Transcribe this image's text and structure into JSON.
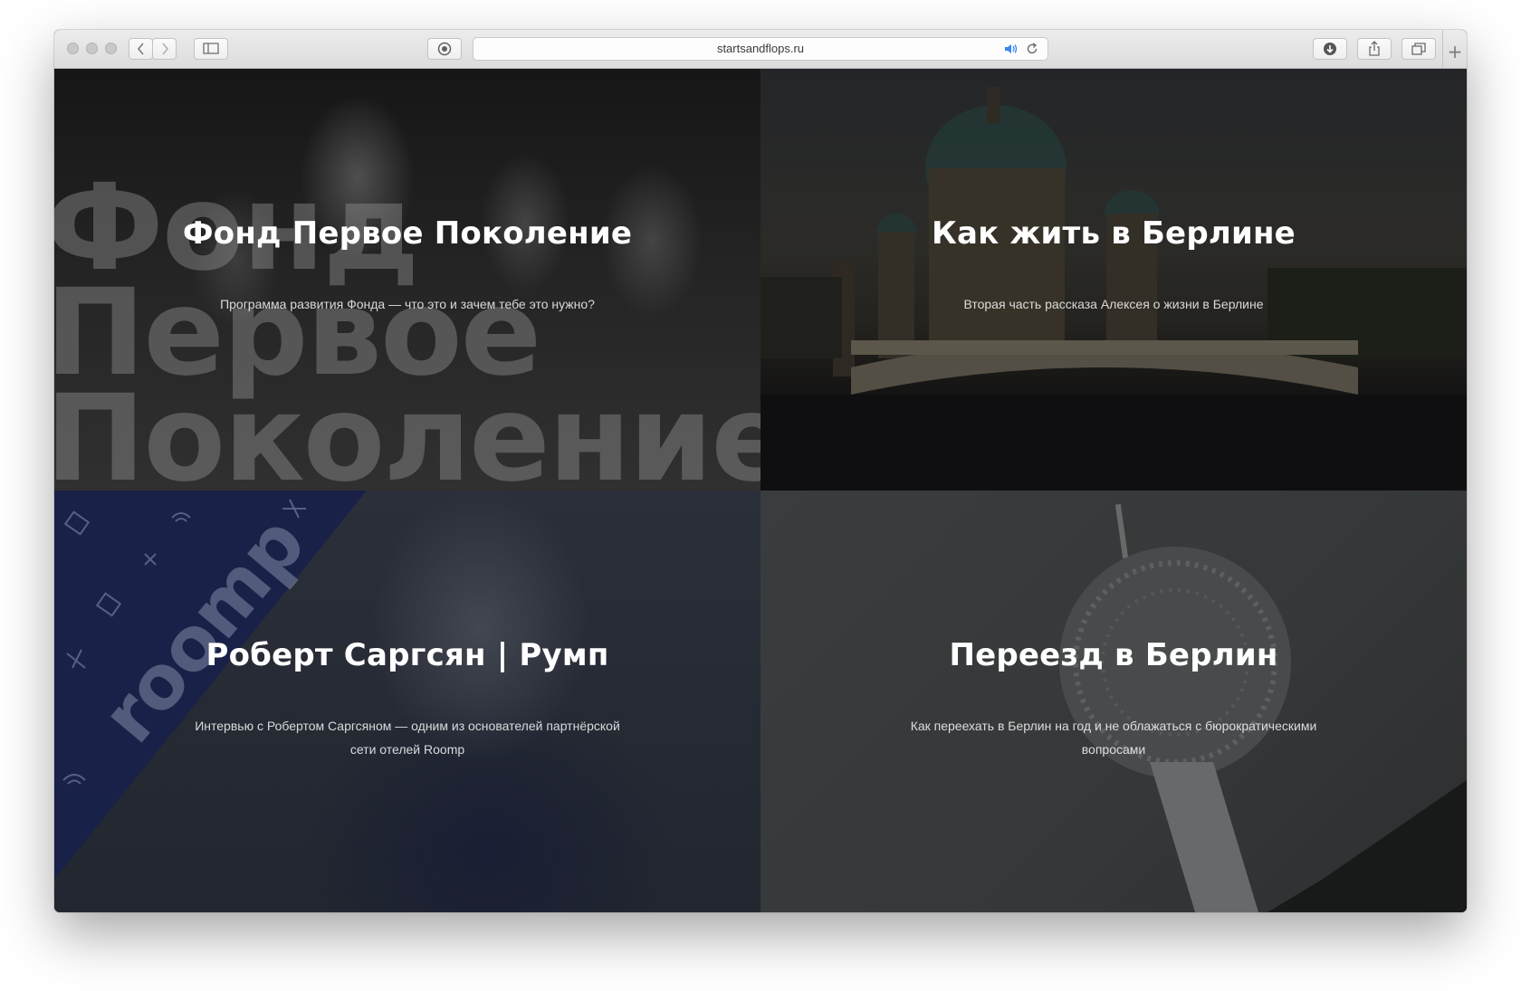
{
  "browser": {
    "url": "startsandflops.ru",
    "icons": {
      "back": "chevron-left-icon",
      "forward": "chevron-right-icon",
      "sidebar": "sidebar-icon",
      "extension": "camera-icon",
      "audio": "speaker-icon",
      "reload": "reload-icon",
      "download": "download-icon",
      "share": "share-icon",
      "tabs": "tabs-icon",
      "new_tab": "plus-icon"
    }
  },
  "cards": [
    {
      "title": "Фонд Первое Поколение",
      "description": "Программа развития Фонда — что это и зачем тебе это нужно?",
      "background_words": [
        "Фонд",
        "Первое",
        "Поколение"
      ]
    },
    {
      "title": "Как жить в Берлине",
      "description": "Вторая часть рассказа Алексея о жизни в Берлине"
    },
    {
      "title": "Роберт Саргсян | Румп",
      "description": "Интервью с Робертом Саргсяном — одним из основателей партнёрской сети отелей Roomp",
      "logo_text": "roomp"
    },
    {
      "title": "Переезд в Берлин",
      "description": "Как переехать в Берлин на год и не облажаться с бюрократическими вопросами"
    }
  ],
  "colors": {
    "roomp_blue": "#18214a",
    "title_text": "#ffffff",
    "audio_accent": "#3b86f0"
  }
}
